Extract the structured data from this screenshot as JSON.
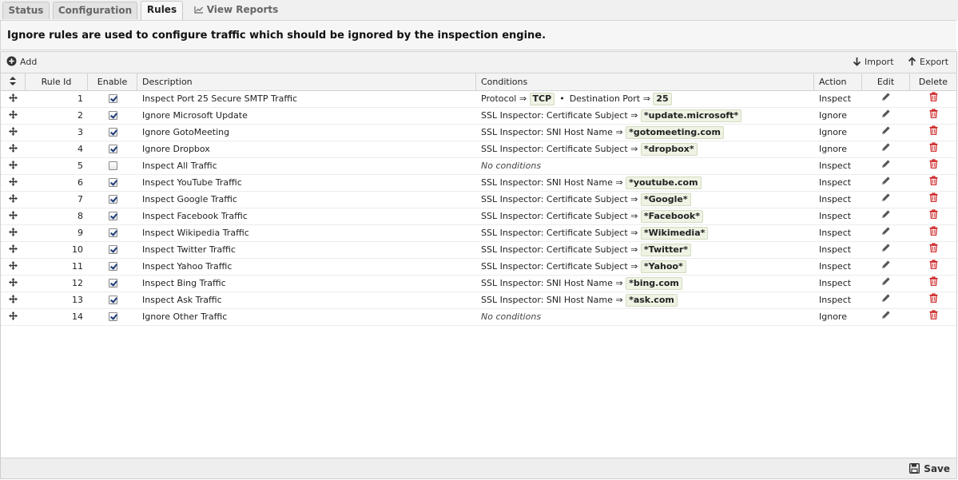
{
  "tabs": [
    {
      "label": "Status"
    },
    {
      "label": "Configuration"
    },
    {
      "label": "Rules"
    },
    {
      "label": "View Reports"
    }
  ],
  "banner": "Ignore rules are used to configure traffic which should be ignored by the inspection engine.",
  "toolbar": {
    "add": "Add",
    "import": "Import",
    "export": "Export"
  },
  "columns": {
    "rule_id": "Rule Id",
    "enable": "Enable",
    "description": "Description",
    "conditions": "Conditions",
    "action": "Action",
    "edit": "Edit",
    "delete": "Delete"
  },
  "rows": [
    {
      "id": "1",
      "enabled": true,
      "description": "Inspect Port 25 Secure SMTP Traffic",
      "cond_type": "tcp",
      "action": "Inspect"
    },
    {
      "id": "2",
      "enabled": true,
      "description": "Ignore Microsoft Update",
      "cond_prefix": "SSL Inspector: Certificate Subject ⇒",
      "cond_value": "*update.microsoft*",
      "action": "Ignore"
    },
    {
      "id": "3",
      "enabled": true,
      "description": "Ignore GotoMeeting",
      "cond_prefix": "SSL Inspector: SNI Host Name ⇒",
      "cond_value": "*gotomeeting.com",
      "action": "Ignore"
    },
    {
      "id": "4",
      "enabled": true,
      "description": "Ignore Dropbox",
      "cond_prefix": "SSL Inspector: Certificate Subject ⇒",
      "cond_value": "*dropbox*",
      "action": "Ignore"
    },
    {
      "id": "5",
      "enabled": false,
      "description": "Inspect All Traffic",
      "cond_none": "No conditions",
      "action": "Inspect"
    },
    {
      "id": "6",
      "enabled": true,
      "description": "Inspect YouTube Traffic",
      "cond_prefix": "SSL Inspector: SNI Host Name ⇒",
      "cond_value": "*youtube.com",
      "action": "Inspect"
    },
    {
      "id": "7",
      "enabled": true,
      "description": "Inspect Google Traffic",
      "cond_prefix": "SSL Inspector: Certificate Subject ⇒",
      "cond_value": "*Google*",
      "action": "Inspect"
    },
    {
      "id": "8",
      "enabled": true,
      "description": "Inspect Facebook Traffic",
      "cond_prefix": "SSL Inspector: Certificate Subject ⇒",
      "cond_value": "*Facebook*",
      "action": "Inspect"
    },
    {
      "id": "9",
      "enabled": true,
      "description": "Inspect Wikipedia Traffic",
      "cond_prefix": "SSL Inspector: Certificate Subject ⇒",
      "cond_value": "*Wikimedia*",
      "action": "Inspect"
    },
    {
      "id": "10",
      "enabled": true,
      "description": "Inspect Twitter Traffic",
      "cond_prefix": "SSL Inspector: Certificate Subject ⇒",
      "cond_value": "*Twitter*",
      "action": "Inspect"
    },
    {
      "id": "11",
      "enabled": true,
      "description": "Inspect Yahoo Traffic",
      "cond_prefix": "SSL Inspector: Certificate Subject ⇒",
      "cond_value": "*Yahoo*",
      "action": "Inspect"
    },
    {
      "id": "12",
      "enabled": true,
      "description": "Inspect Bing Traffic",
      "cond_prefix": "SSL Inspector: SNI Host Name ⇒",
      "cond_value": "*bing.com",
      "action": "Inspect"
    },
    {
      "id": "13",
      "enabled": true,
      "description": "Inspect Ask Traffic",
      "cond_prefix": "SSL Inspector: SNI Host Name ⇒",
      "cond_value": "*ask.com",
      "action": "Inspect"
    },
    {
      "id": "14",
      "enabled": true,
      "description": "Ignore Other Traffic",
      "cond_none": "No conditions",
      "action": "Ignore"
    }
  ],
  "row1_conditions": {
    "protocol_label": "Protocol ⇒",
    "protocol_value": "TCP",
    "bullet": "•",
    "port_label": "Destination Port ⇒",
    "port_value": "25"
  },
  "footer": {
    "save": "Save"
  },
  "colors": {
    "delete_icon": "#cc1f1f",
    "pill_bg": "#eef3e4"
  },
  "icons": {
    "add": "plus-circle-icon",
    "import": "arrow-down-icon",
    "export": "arrow-up-icon",
    "reports": "chart-line-icon",
    "edit": "pencil-icon",
    "delete": "trash-icon",
    "drag": "move-icon",
    "save": "floppy-icon"
  }
}
